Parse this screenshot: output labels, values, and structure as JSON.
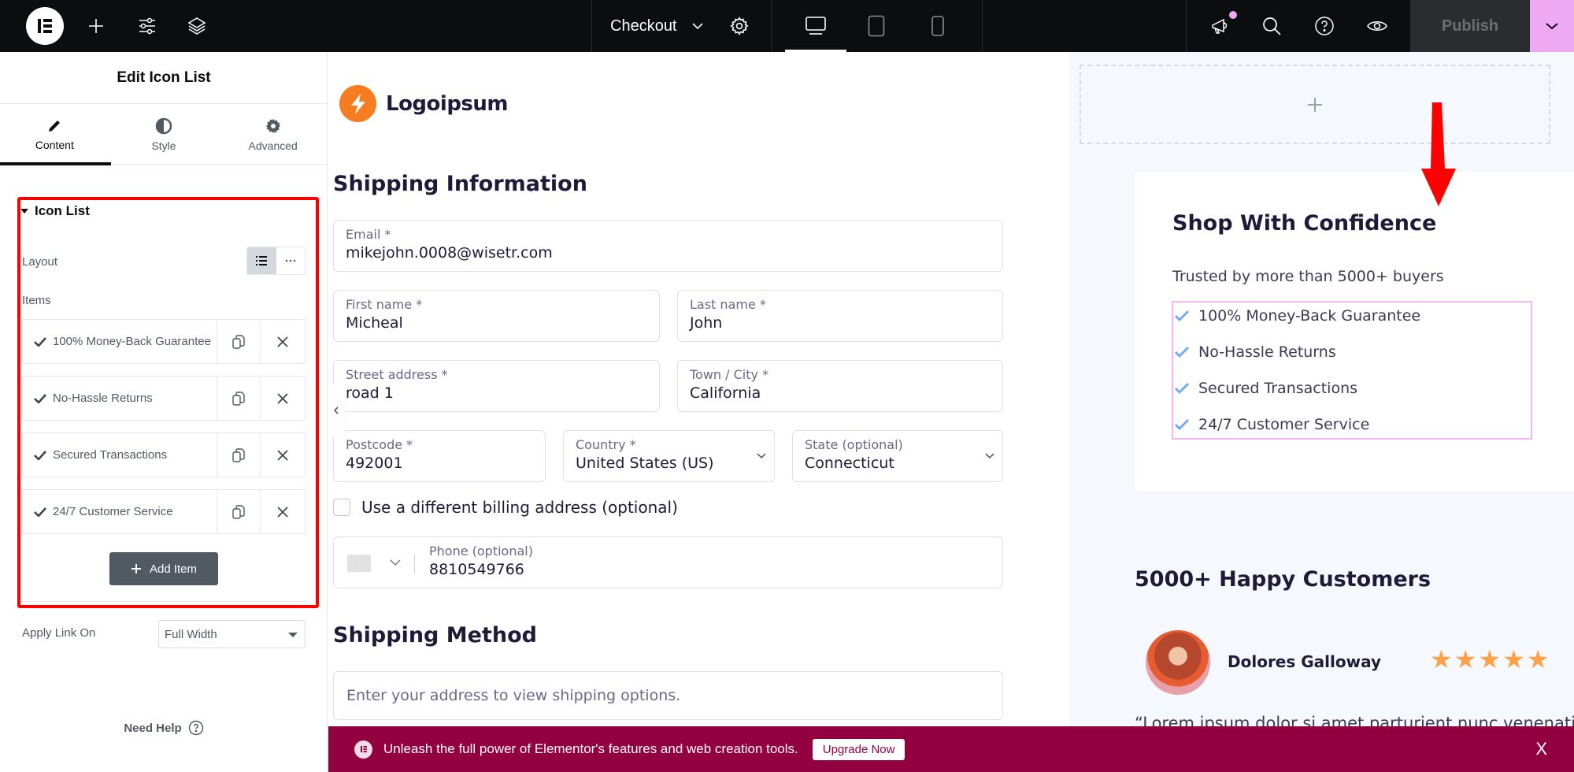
{
  "topbar": {
    "page_title": "Checkout",
    "publish_label": "Publish",
    "icons": [
      "elementor-logo-icon",
      "add-icon",
      "site-settings-sliders-icon",
      "structure-layers-icon",
      "page-settings-gear-icon",
      "desktop-icon",
      "tablet-icon",
      "mobile-icon",
      "whats-new-megaphone-icon",
      "search-icon",
      "help-icon",
      "preview-eye-icon",
      "chevron-down-icon"
    ],
    "active_device": "desktop"
  },
  "panel": {
    "title": "Edit Icon List",
    "tabs": [
      {
        "label": "Content",
        "icon": "pencil-icon",
        "active": true
      },
      {
        "label": "Style",
        "icon": "contrast-icon",
        "active": false
      },
      {
        "label": "Advanced",
        "icon": "gear-icon",
        "active": false
      }
    ],
    "section_title": "Icon List",
    "layout_label": "Layout",
    "layout_selected": "default-list",
    "items_label": "Items",
    "items": [
      {
        "label": "100% Money-Back Guarantee"
      },
      {
        "label": "No-Hassle Returns"
      },
      {
        "label": "Secured Transactions"
      },
      {
        "label": "24/7 Customer Service"
      }
    ],
    "add_item_label": "Add Item",
    "apply_link_label": "Apply Link On",
    "apply_link_value": "Full Width",
    "help_label": "Need Help"
  },
  "canvas": {
    "brand_name": "Logoipsum",
    "shipping_info_title": "Shipping Information",
    "fields": {
      "email": {
        "label": "Email *",
        "value": "mikejohn.0008@wisetr.com"
      },
      "first_name": {
        "label": "First name *",
        "value": "Micheal"
      },
      "last_name": {
        "label": "Last name *",
        "value": "John"
      },
      "street": {
        "label": "Street address *",
        "value": "road 1"
      },
      "city": {
        "label": "Town / City *",
        "value": "California"
      },
      "postcode": {
        "label": "Postcode *",
        "value": "492001"
      },
      "country": {
        "label": "Country *",
        "value": "United States (US)"
      },
      "state": {
        "label": "State (optional)",
        "value": "Connecticut"
      },
      "phone": {
        "label": "Phone (optional)",
        "value": "8810549766"
      }
    },
    "billing_checkbox_label": "Use a different billing address (optional)",
    "billing_checkbox_checked": false,
    "shipping_method_title": "Shipping Method",
    "shipping_method_note": "Enter your address to view shipping options.",
    "confidence": {
      "title": "Shop With Confidence",
      "subtitle": "Trusted by more than 5000+ buyers",
      "items": [
        "100% Money-Back Guarantee",
        "No-Hassle Returns",
        "Secured Transactions",
        "24/7 Customer Service"
      ],
      "check_color": "#6ea8f7"
    },
    "testimonials": {
      "title": "5000+ Happy Customers",
      "reviewer": "Dolores Galloway",
      "rating": 5,
      "rating_max": 5,
      "quote": "“Lorem ipsum dolor si amet parturient nunc venenati"
    }
  },
  "promo": {
    "text": "Unleash the full power of Elementor's features and web creation tools.",
    "button_label": "Upgrade Now",
    "close_label": "X",
    "color": "#93003f"
  },
  "colors": {
    "annotation_red": "#ff0000",
    "publish_accent": "#eea8f4",
    "brand_orange": "#f57c1f",
    "star_color": "#ffa149"
  }
}
